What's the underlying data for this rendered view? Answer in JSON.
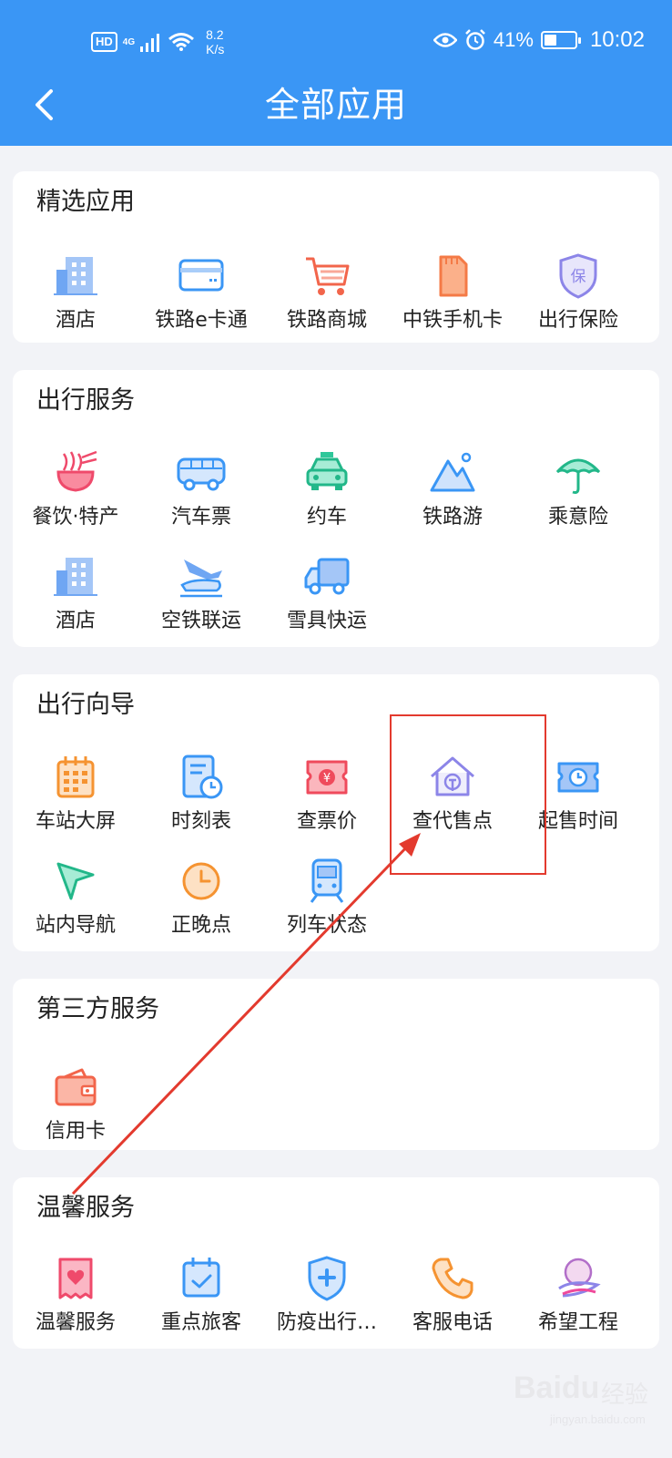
{
  "status_bar": {
    "hd": "HD",
    "network": "4G",
    "speed_value": "8.2",
    "speed_unit": "K/s",
    "battery_percent": "41%",
    "battery_level": 0.41,
    "time": "10:02"
  },
  "header": {
    "title": "全部应用"
  },
  "sections": [
    {
      "title": "精选应用",
      "items": [
        {
          "label": "酒店",
          "icon": "hotel-icon"
        },
        {
          "label": "铁路e卡通",
          "icon": "card-icon"
        },
        {
          "label": "铁路商城",
          "icon": "shopping-cart-icon"
        },
        {
          "label": "中铁手机卡",
          "icon": "sim-card-icon"
        },
        {
          "label": "出行保险",
          "icon": "insurance-shield-icon"
        }
      ]
    },
    {
      "title": "出行服务",
      "items": [
        {
          "label": "餐饮·特产",
          "icon": "noodle-bowl-icon"
        },
        {
          "label": "汽车票",
          "icon": "bus-icon"
        },
        {
          "label": "约车",
          "icon": "taxi-icon"
        },
        {
          "label": "铁路游",
          "icon": "mountain-icon"
        },
        {
          "label": "乘意险",
          "icon": "umbrella-icon"
        },
        {
          "label": "酒店",
          "icon": "hotel-icon"
        },
        {
          "label": "空铁联运",
          "icon": "plane-train-icon"
        },
        {
          "label": "雪具快运",
          "icon": "truck-icon"
        }
      ]
    },
    {
      "title": "出行向导",
      "items": [
        {
          "label": "车站大屏",
          "icon": "calendar-grid-icon"
        },
        {
          "label": "时刻表",
          "icon": "timetable-icon"
        },
        {
          "label": "查票价",
          "icon": "ticket-price-icon"
        },
        {
          "label": "查代售点",
          "icon": "house-railway-icon"
        },
        {
          "label": "起售时间",
          "icon": "ticket-clock-icon"
        },
        {
          "label": "站内导航",
          "icon": "navigation-arrow-icon"
        },
        {
          "label": "正晚点",
          "icon": "clock-icon"
        },
        {
          "label": "列车状态",
          "icon": "train-icon"
        }
      ]
    },
    {
      "title": "第三方服务",
      "items": [
        {
          "label": "信用卡",
          "icon": "wallet-icon"
        }
      ]
    },
    {
      "title": "温馨服务",
      "items": [
        {
          "label": "温馨服务",
          "icon": "heart-card-icon"
        },
        {
          "label": "重点旅客",
          "icon": "calendar-check-icon"
        },
        {
          "label": "防疫出行…",
          "icon": "medical-shield-icon"
        },
        {
          "label": "客服电话",
          "icon": "phone-icon"
        },
        {
          "label": "希望工程",
          "icon": "hope-logo-icon"
        }
      ]
    }
  ],
  "watermark": {
    "brand": "Baidu",
    "cn": "经验",
    "sub": "jingyan.baidu.com"
  },
  "colors": {
    "header": "#3a96f5",
    "highlight": "#e33a2e"
  }
}
